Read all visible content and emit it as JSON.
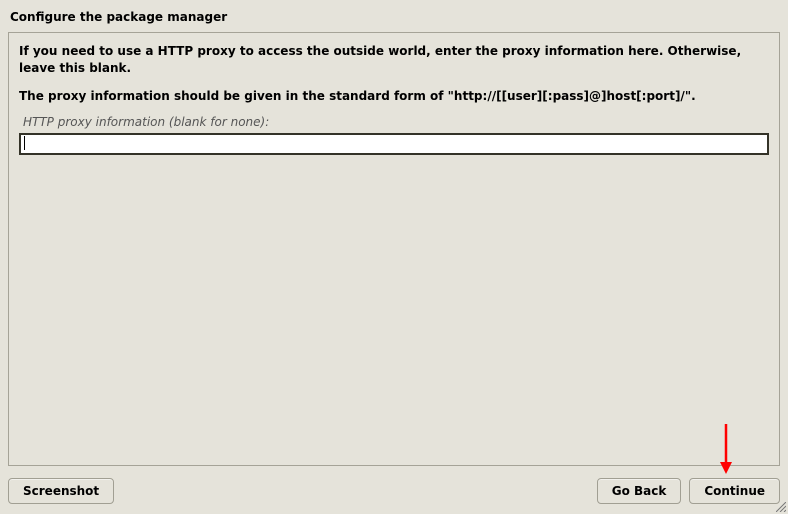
{
  "title": "Configure the package manager",
  "instruction1": "If you need to use a HTTP proxy to access the outside world, enter the proxy information here. Otherwise, leave this blank.",
  "instruction2": "The proxy information should be given in the standard form of \"http://[[user][:pass]@]host[:port]/\".",
  "field_label": "HTTP proxy information (blank for none):",
  "proxy_value": "",
  "buttons": {
    "screenshot": "Screenshot",
    "go_back": "Go Back",
    "continue": "Continue"
  }
}
